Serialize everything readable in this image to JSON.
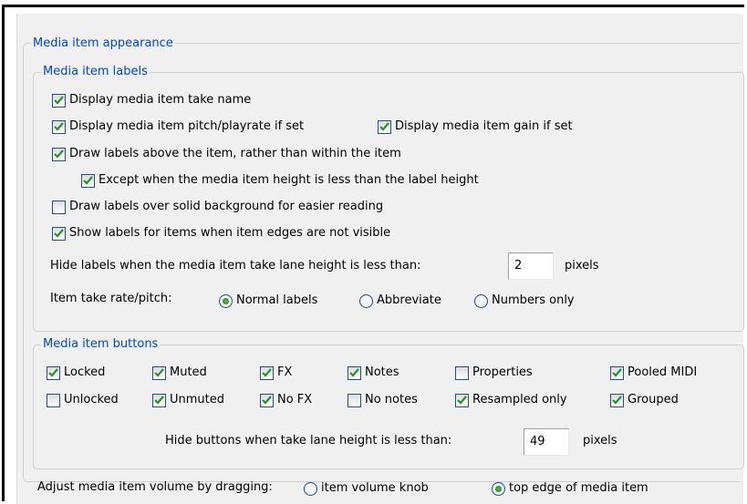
{
  "appearance": {
    "legend": "Media item appearance",
    "labels_group": {
      "legend": "Media item labels",
      "take_name": {
        "label": "Display media item take name",
        "checked": true
      },
      "pitch": {
        "label": "Display media item pitch/playrate if set",
        "checked": true
      },
      "gain": {
        "label": "Display media item gain if set",
        "checked": true
      },
      "above": {
        "label": "Draw labels above the item, rather than within the item",
        "checked": true
      },
      "except": {
        "label": "Except when the media item height is less than the label height",
        "checked": true
      },
      "solid_bg": {
        "label": "Draw labels over solid background for easier reading",
        "checked": false
      },
      "edges": {
        "label": "Show labels for items when item edges are not visible",
        "checked": true
      },
      "hide_labels": {
        "label": "Hide labels when the media item take lane height is less than:",
        "value": "2",
        "unit": "pixels"
      },
      "rate_pitch": {
        "label": "Item take rate/pitch:",
        "options": [
          {
            "label": "Normal labels",
            "checked": true
          },
          {
            "label": "Abbreviate",
            "checked": false
          },
          {
            "label": "Numbers only",
            "checked": false
          }
        ]
      }
    },
    "buttons_group": {
      "legend": "Media item buttons",
      "row1": [
        {
          "label": "Locked",
          "checked": true
        },
        {
          "label": "Muted",
          "checked": true
        },
        {
          "label": "FX",
          "checked": true
        },
        {
          "label": "Notes",
          "checked": true
        },
        {
          "label": "Properties",
          "checked": false
        },
        {
          "label": "Pooled MIDI",
          "checked": true
        }
      ],
      "row2": [
        {
          "label": "Unlocked",
          "checked": false
        },
        {
          "label": "Unmuted",
          "checked": true
        },
        {
          "label": "No FX",
          "checked": true
        },
        {
          "label": "No notes",
          "checked": false
        },
        {
          "label": "Resampled only",
          "checked": true
        },
        {
          "label": "Grouped",
          "checked": true
        }
      ],
      "hide_buttons": {
        "label": "Hide buttons when take lane height is less than:",
        "value": "49",
        "unit": "pixels"
      }
    },
    "volume_drag": {
      "label": "Adjust media item volume by dragging:",
      "options": [
        {
          "label": "item volume knob",
          "checked": false
        },
        {
          "label": "top edge of media item",
          "checked": true
        }
      ]
    }
  },
  "colors": {
    "legend": "#0046d5",
    "check": "#2a8f2a",
    "border": "#1c5180"
  }
}
